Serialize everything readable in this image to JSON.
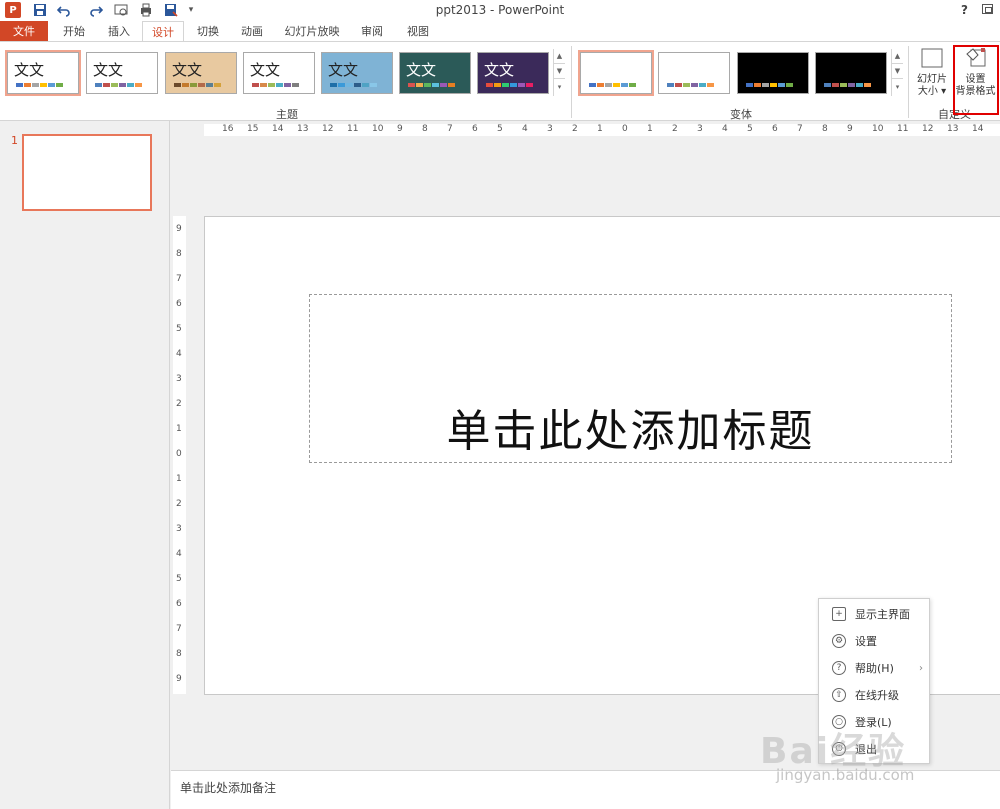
{
  "window": {
    "title": "ppt2013 - PowerPoint",
    "help": "?",
    "app_icon": "P"
  },
  "tabs": [
    "文件",
    "开始",
    "插入",
    "设计",
    "切换",
    "动画",
    "幻灯片放映",
    "审阅",
    "视图"
  ],
  "active_tab": "设计",
  "ribbon": {
    "themes_group_label": "主题",
    "variants_group_label": "变体",
    "customize_group_label": "自定义",
    "theme_sample_text": "文文",
    "slide_size_label_1": "幻灯片",
    "slide_size_label_2": "大小",
    "format_bg_label_1": "设置",
    "format_bg_label_2": "背景格式",
    "themes": [
      {
        "bg": "#ffffff",
        "text": "#222222",
        "colors": [
          "#4472c4",
          "#ed7d31",
          "#a5a5a5",
          "#ffc000",
          "#5b9bd5",
          "#70ad47"
        ]
      },
      {
        "bg": "#ffffff",
        "text": "#222222",
        "colors": [
          "#4f81bd",
          "#c0504d",
          "#9bbb59",
          "#8064a2",
          "#4bacc6",
          "#f79646"
        ]
      },
      {
        "bg": "#e8c9a0",
        "text": "#222222",
        "colors": [
          "#6b4a2b",
          "#c47a2c",
          "#8a9a3a",
          "#b36a4a",
          "#5a7f93",
          "#d4a13a"
        ]
      },
      {
        "bg": "#ffffff",
        "text": "#222222",
        "colors": [
          "#c0504d",
          "#d8894a",
          "#9bbb59",
          "#4bacc6",
          "#8064a2",
          "#7f7f7f"
        ]
      },
      {
        "bg": "#7fb3d5",
        "text": "#222222",
        "colors": [
          "#1f6fa8",
          "#3b9ad9",
          "#70b6e0",
          "#2c5d8a",
          "#4fa3c4",
          "#89c7e8"
        ]
      },
      {
        "bg": "#2b5a58",
        "text": "#ffffff",
        "colors": [
          "#d9534f",
          "#f0ad4e",
          "#5cb85c",
          "#5bc0de",
          "#9b59b6",
          "#e67e22"
        ]
      },
      {
        "bg": "#3b2a5a",
        "text": "#ffffff",
        "colors": [
          "#e74c3c",
          "#f39c12",
          "#2ecc71",
          "#3498db",
          "#9b59b6",
          "#e91e63"
        ]
      }
    ],
    "variants": [
      {
        "bg": "#ffffff",
        "colors": [
          "#4472c4",
          "#ed7d31",
          "#a5a5a5",
          "#ffc000",
          "#5b9bd5",
          "#70ad47"
        ]
      },
      {
        "bg": "#ffffff",
        "colors": [
          "#4f81bd",
          "#c0504d",
          "#9bbb59",
          "#8064a2",
          "#4bacc6",
          "#f79646"
        ]
      },
      {
        "bg": "#000000",
        "colors": [
          "#4472c4",
          "#ed7d31",
          "#a5a5a5",
          "#ffc000",
          "#5b9bd5",
          "#70ad47"
        ]
      },
      {
        "bg": "#000000",
        "colors": [
          "#4f81bd",
          "#c0504d",
          "#9bbb59",
          "#8064a2",
          "#4bacc6",
          "#f79646"
        ]
      }
    ]
  },
  "thumbnails": [
    {
      "number": "1"
    }
  ],
  "rulers": {
    "horizontal": [
      "16",
      "15",
      "14",
      "13",
      "12",
      "11",
      "10",
      "9",
      "8",
      "7",
      "6",
      "5",
      "4",
      "3",
      "2",
      "1",
      "0",
      "1",
      "2",
      "3",
      "4",
      "5",
      "6",
      "7",
      "8",
      "9",
      "10",
      "11",
      "12",
      "13",
      "14"
    ],
    "vertical": [
      "9",
      "8",
      "7",
      "6",
      "5",
      "4",
      "3",
      "2",
      "1",
      "0",
      "1",
      "2",
      "3",
      "4",
      "5",
      "6",
      "7",
      "8",
      "9"
    ]
  },
  "slide": {
    "title_placeholder": "单击此处添加标题"
  },
  "notes": {
    "placeholder": "单击此处添加备注"
  },
  "context_menu": {
    "items": [
      {
        "label": "显示主界面",
        "icon": "plus-square-icon",
        "glyph": "+"
      },
      {
        "label": "设置",
        "icon": "gear-icon",
        "glyph": "⚙"
      },
      {
        "label": "帮助(H)",
        "icon": "help-icon",
        "glyph": "?",
        "submenu": true
      },
      {
        "label": "在线升级",
        "icon": "upgrade-icon",
        "glyph": "⇧"
      },
      {
        "label": "登录(L)",
        "icon": "login-icon",
        "glyph": "○"
      },
      {
        "label": "退出",
        "icon": "power-icon",
        "glyph": "⏻"
      }
    ]
  },
  "watermark": {
    "main": "Bai经验",
    "sub": "jingyan.baidu.com"
  },
  "colors": {
    "accent": "#d24726",
    "highlight_box": "#e00000",
    "selected_thumb_border": "#e8775a"
  }
}
